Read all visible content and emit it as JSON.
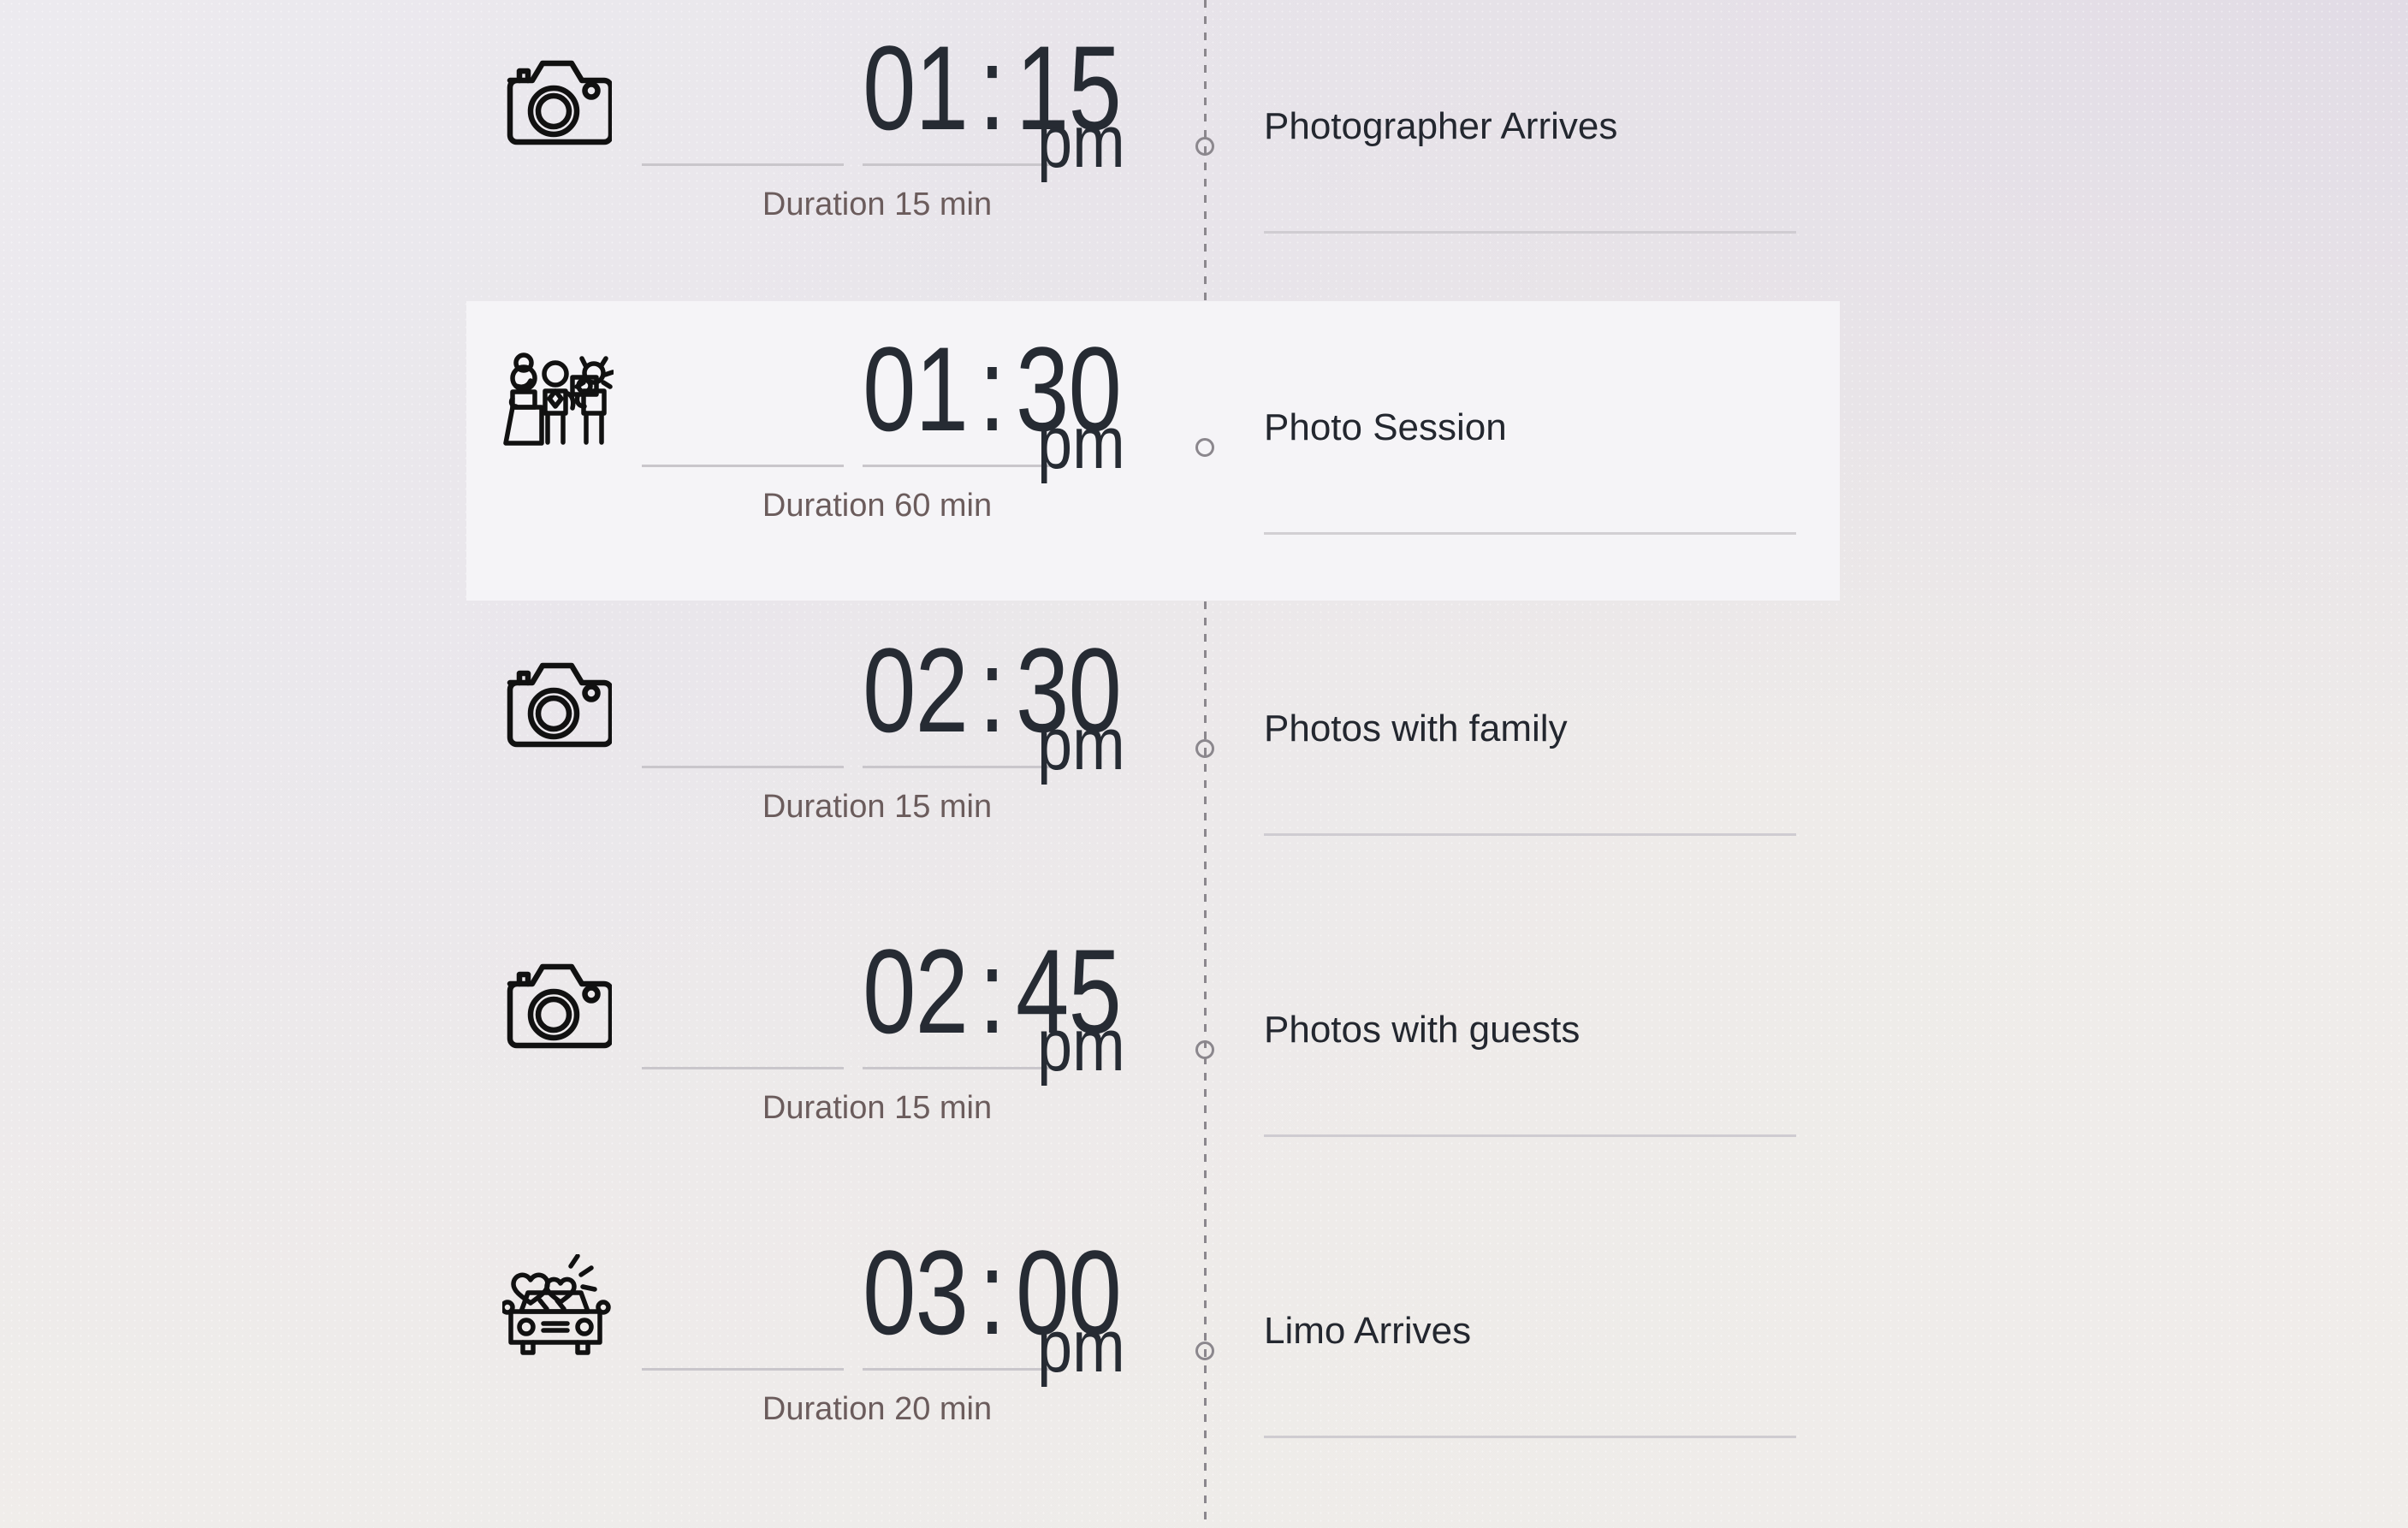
{
  "theme": {
    "background_top_left": "#eceaef",
    "background_top_right": "#e4e0e7",
    "background_bottom_left": "#f0edea",
    "highlight_panel": "#f5f4f7",
    "time_text": "#262b33",
    "duration_text": "#6b5c5c",
    "event_text": "#23272f",
    "rule": "#cfccd1",
    "spine": "#8b878d"
  },
  "timeline": {
    "meridiem_default": "pm",
    "duration_prefix": "Duration",
    "duration_suffix": "min",
    "events": [
      {
        "hour": "01",
        "colon": ":",
        "minute": "15",
        "meridiem": "pm",
        "duration": "Duration 15 min",
        "duration_minutes": 15,
        "label": "Photographer Arrives",
        "icon": "camera-icon",
        "highlighted": false
      },
      {
        "hour": "01",
        "colon": ":",
        "minute": "30",
        "meridiem": "pm",
        "duration": "Duration 60 min",
        "duration_minutes": 60,
        "label": "Photo Session",
        "icon": "wedding-couple-photographer-icon",
        "highlighted": true
      },
      {
        "hour": "02",
        "colon": ":",
        "minute": "30",
        "meridiem": "pm",
        "duration": "Duration 15 min",
        "duration_minutes": 15,
        "label": "Photos with family",
        "icon": "camera-icon",
        "highlighted": false
      },
      {
        "hour": "02",
        "colon": ":",
        "minute": "45",
        "meridiem": "pm",
        "duration": "Duration 15 min",
        "duration_minutes": 15,
        "label": "Photos with guests",
        "icon": "camera-icon",
        "highlighted": false
      },
      {
        "hour": "03",
        "colon": ":",
        "minute": "00",
        "meridiem": "pm",
        "duration": "Duration 20 min",
        "duration_minutes": 20,
        "label": "Limo Arrives",
        "icon": "limo-car-hearts-icon",
        "highlighted": false
      }
    ]
  }
}
